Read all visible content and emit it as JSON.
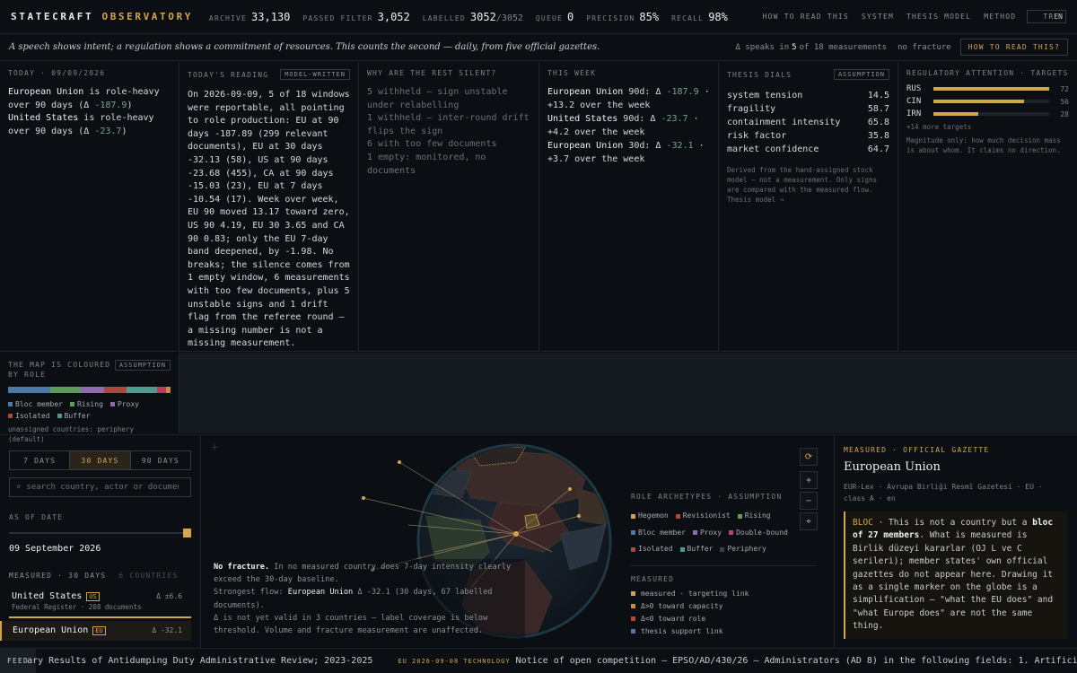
{
  "brand": {
    "name": "STATECRAFT",
    "accent": "OBSERVATORY"
  },
  "stats": [
    {
      "label": "ARCHIVE",
      "value": "33,130",
      "sub": ""
    },
    {
      "label": "PASSED FILTER",
      "value": "3,052",
      "sub": ""
    },
    {
      "label": "LABELLED",
      "value": "3052",
      "sub": "/3052"
    },
    {
      "label": "QUEUE",
      "value": "0",
      "sub": ""
    },
    {
      "label": "PRECISION",
      "value": "85%",
      "sub": ""
    },
    {
      "label": "RECALL",
      "value": "98%",
      "sub": ""
    }
  ],
  "nav": [
    "HOW TO READ THIS",
    "SYSTEM",
    "THESIS MODEL",
    "METHOD"
  ],
  "lang": {
    "active": "TR",
    "other": "EN"
  },
  "tagline": "A speech shows intent; a regulation shows a commitment of resources. This counts the second — daily, from five official gazettes.",
  "tagright": {
    "pre": "Δ speaks in",
    "n": "5",
    "post": "of 18 measurements",
    "fracture": "no fracture",
    "button": "HOW TO READ THIS?"
  },
  "today": {
    "title": "TODAY · 09/09/2026",
    "line1_name": "European Union",
    "line1_text": " is role-heavy over 90 days (Δ ",
    "line1_val": "-187.9",
    "line1_end": ")",
    "line2_name": "United States",
    "line2_text": " is role-heavy over 90 days (Δ ",
    "line2_val": "-23.7",
    "line2_end": ")"
  },
  "reading": {
    "title": "TODAY'S READING",
    "tag": "MODEL-WRITTEN",
    "text": "On 2026-09-09, 5 of 18 windows were reportable, all pointing to role production: EU at 90 days -187.89 (299 relevant documents), EU at 30 days -32.13 (58), US at 90 days -23.68 (455), CA at 90 days -15.03 (23), EU at 7 days -10.54 (17). Week over week, EU 90 moved 13.17 toward zero, US 90 4.19, EU 30 3.65 and CA 90 0.83; only the EU 7-day band deepened, by -1.98. No breaks; the silence comes from 1 empty window, 6 measurements with too few documents, plus 5 unstable signs and 1 drift flag from the referee round — a missing number is not a missing measurement."
  },
  "silent": {
    "title": "WHY ARE THE REST SILENT?",
    "items": [
      "5 withheld — sign unstable under relabelling",
      "1 withheld — inter-round drift flips the sign",
      "6 with too few documents",
      "1 empty: monitored, no documents"
    ]
  },
  "week": {
    "title": "THIS WEEK",
    "items": [
      {
        "name": "European Union",
        "mid": " 90d: Δ ",
        "val": "-187.9",
        "end": " · +13.2 over the week"
      },
      {
        "name": "United States",
        "mid": " 90d: Δ ",
        "val": "-23.7",
        "end": " · +4.2 over the week"
      },
      {
        "name": "European Union",
        "mid": " 30d: Δ ",
        "val": "-32.1",
        "end": " · +3.7 over the week"
      }
    ]
  },
  "dials": {
    "title": "THESIS DIALS",
    "tag": "ASSUMPTION",
    "items": [
      {
        "label": "system tension",
        "value": "14.5"
      },
      {
        "label": "fragility",
        "value": "58.7"
      },
      {
        "label": "containment intensity",
        "value": "65.8"
      },
      {
        "label": "risk factor",
        "value": "35.8"
      },
      {
        "label": "market confidence",
        "value": "64.7"
      }
    ],
    "note": "Derived from the hand-assigned stock model — not a measurement. Only signs are compared with the measured flow. Thesis model →"
  },
  "attention": {
    "title": "REGULATORY ATTENTION · TARGETS",
    "items": [
      {
        "code": "RUS",
        "value": 72,
        "pct": 1.0
      },
      {
        "code": "CIN",
        "value": 56,
        "pct": 0.78
      },
      {
        "code": "IRN",
        "value": 28,
        "pct": 0.39
      }
    ],
    "more": "+14 more targets",
    "note": "Magnitude only: how much decision mass is about whom. It claims no direction."
  },
  "maplegend": {
    "title": "THE MAP IS COLOURED BY ROLE",
    "tag": "ASSUMPTION",
    "items": [
      {
        "label": "Bloc member",
        "color": "#4f7aa8"
      },
      {
        "label": "Rising",
        "color": "#5f9a5a"
      },
      {
        "label": "Proxy",
        "color": "#8c6bb0"
      },
      {
        "label": "Isolated",
        "color": "#a84a3f"
      },
      {
        "label": "Buffer",
        "color": "#4e9a8f"
      }
    ],
    "strip": [
      {
        "color": "#4f7aa8",
        "w": 0.26
      },
      {
        "color": "#5f9a5a",
        "w": 0.19
      },
      {
        "color": "#8c6bb0",
        "w": 0.14
      },
      {
        "color": "#a84a3f",
        "w": 0.14
      },
      {
        "color": "#4e9a8f",
        "w": 0.19
      },
      {
        "color": "#c23a5a",
        "w": 0.05
      },
      {
        "color": "#d4873a",
        "w": 0.03
      }
    ],
    "note": "unassigned countries: periphery (default)"
  },
  "range": {
    "options": [
      "7 DAYS",
      "30 DAYS",
      "90 DAYS"
    ],
    "active": "30 DAYS"
  },
  "search": {
    "placeholder": "search country, actor or document"
  },
  "asof": {
    "label": "AS OF DATE",
    "date": "09 September 2026"
  },
  "measured": {
    "label": "MEASURED · 30 DAYS",
    "other": "6 COUNTRIES",
    "countries": [
      {
        "name": "United States",
        "iso": "US",
        "delta": "Δ ±6.6",
        "src": "Federal Register · 208 documents"
      },
      {
        "name": "European Union",
        "iso": "EU",
        "delta": "Δ -32.1",
        "src": ""
      }
    ]
  },
  "globe_note": {
    "fracture_bold": "No fracture.",
    "fracture_text": " In no measured country does 7-day intensity clearly exceed the 30-day baseline.",
    "flow_pre": "Strongest flow: ",
    "flow_name": "European Union",
    "flow_text": " Δ -32.1 (30 days, 67 labelled documents).",
    "valid": "Δ is not yet valid in 3 countries — label coverage is below threshold. Volume and fracture measurement are unaffected."
  },
  "archetypes": {
    "title": "ROLE ARCHETYPES · ASSUMPTION",
    "items": [
      {
        "label": "Hegemon",
        "color": "#d4a64a"
      },
      {
        "label": "Revisionist",
        "color": "#b8443a"
      },
      {
        "label": "Rising",
        "color": "#5f9a5a"
      },
      {
        "label": "Bloc member",
        "color": "#4f7aa8"
      },
      {
        "label": "Proxy",
        "color": "#8c6bb0"
      },
      {
        "label": "Double-bound",
        "color": "#c23a7a"
      },
      {
        "label": "Isolated",
        "color": "#a84a3f"
      },
      {
        "label": "Buffer",
        "color": "#4e9a8f"
      },
      {
        "label": "Periphery",
        "color": "#3a4048"
      }
    ],
    "measured_title": "MEASURED",
    "measured_items": [
      {
        "label": "measured · targeting link",
        "color": "#d4a64a"
      },
      {
        "label": "Δ>0 toward capacity",
        "color": "#d4873a"
      },
      {
        "label": "Δ<0 toward role",
        "color": "#b8443a"
      },
      {
        "label": "thesis support link",
        "color": "#4f7aa8"
      }
    ]
  },
  "info": {
    "kicker": "MEASURED · OFFICIAL GAZETTE",
    "title": "European Union",
    "meta": "EUR-Lex · Avrupa Birliği Resmî Gazetesi · EU · class A · en",
    "bloc": "BLOC",
    "p1": " · This is not a country but a ",
    "bold1": "bloc of 27 members",
    "p2": ". What is measured is Birlik düzeyi kararlar (OJ L ve C serileri); member states' own official gazettes do not appear here. Drawing it as a single marker on the globe is a simplification — \"what the EU does\" and \"what Europe does\" are not the same thing."
  },
  "ticker": {
    "feed": "FEED",
    "item1": "ary Results of Antidumping Duty Administrative Review; 2023-2025",
    "item2_tag": "EU 2026-09-08 TECHNOLOGY",
    "item2": "Notice of open competition – EPSO/AD/430/26 – Administrators (AD 8) in the following fields: 1. Artificial in"
  },
  "controls": [
    "⟳",
    "+",
    "−",
    "⌖"
  ]
}
